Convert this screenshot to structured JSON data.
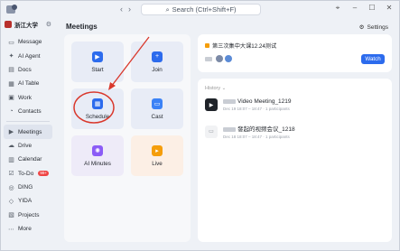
{
  "titlebar": {
    "search_placeholder": "Search (Ctrl+Shift+F)",
    "back_icon": "arrow-left-icon",
    "forward_icon": "arrow-right-icon"
  },
  "sidebar": {
    "org_name": "浙江大学",
    "items": [
      {
        "label": "Message",
        "icon": "message-icon"
      },
      {
        "label": "AI Agent",
        "icon": "ai-agent-icon"
      },
      {
        "label": "Docs",
        "icon": "docs-icon"
      },
      {
        "label": "AI Table",
        "icon": "table-icon"
      },
      {
        "label": "Work",
        "icon": "work-icon"
      },
      {
        "label": "Contacts",
        "icon": "contacts-icon"
      },
      {
        "label": "Meetings",
        "icon": "meetings-icon",
        "active": true
      },
      {
        "label": "Drive",
        "icon": "drive-icon"
      },
      {
        "label": "Calendar",
        "icon": "calendar-icon"
      },
      {
        "label": "To-Do",
        "icon": "todo-icon",
        "badge": "99+"
      },
      {
        "label": "DING",
        "icon": "ding-icon"
      },
      {
        "label": "YIDA",
        "icon": "yida-icon"
      },
      {
        "label": "Projects",
        "icon": "projects-icon"
      },
      {
        "label": "More",
        "icon": "more-icon"
      }
    ]
  },
  "main": {
    "title": "Meetings",
    "settings_label": "Settings",
    "tiles": [
      {
        "label": "Start",
        "icon": "video-camera-icon"
      },
      {
        "label": "Join",
        "icon": "plus-icon"
      },
      {
        "label": "Schedule",
        "icon": "calendar-schedule-icon"
      },
      {
        "label": "Cast",
        "icon": "cast-icon"
      },
      {
        "label": "AI Minutes",
        "icon": "ai-minutes-icon"
      },
      {
        "label": "Live",
        "icon": "live-icon"
      }
    ],
    "upcoming": {
      "title": "第三次集中大课12.24测试",
      "watch_label": "Watch"
    },
    "history": {
      "label": "History",
      "rows": [
        {
          "title": "Video Meeting_1219",
          "meta": "Dec 19 18:07 – 18:47 · 1 participants"
        },
        {
          "title": "發起的视频会议_1218",
          "meta": "Dec 18 18:07 – 18:47 · 1 participants"
        }
      ]
    }
  },
  "colors": {
    "accent": "#2c6bed",
    "annotation": "#d9382c",
    "sidebar_bg": "#eef1f6"
  }
}
